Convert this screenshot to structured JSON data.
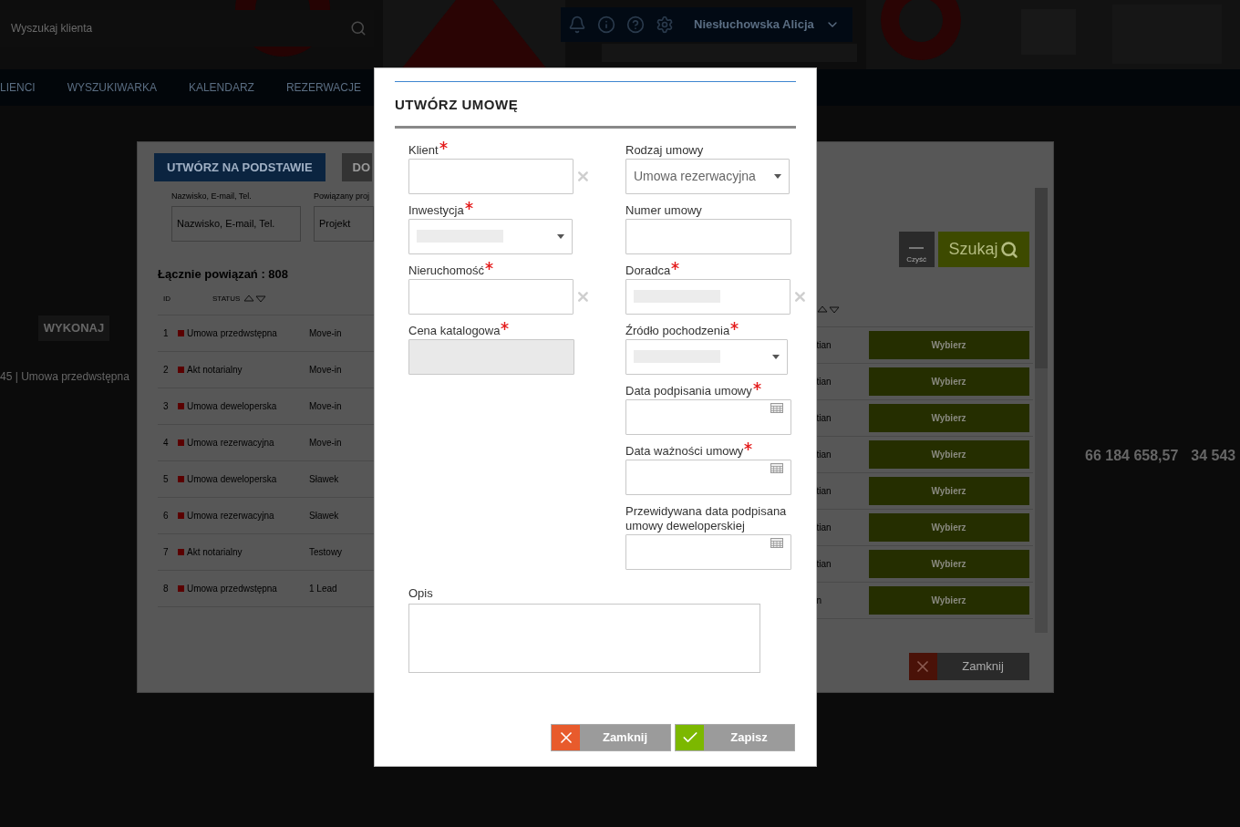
{
  "header": {
    "search_placeholder": "Wyszukaj klienta",
    "user": "Niesłuchowska Alicja"
  },
  "nav": [
    "LIENCI",
    "WYSZUKIWARKA",
    "KALENDARZ",
    "REZERWACJE"
  ],
  "background": {
    "action_button": "WYKONAJ",
    "record_title": "45 | Umowa przedwstępna",
    "totals": [
      "66 184 658,57",
      "34 543"
    ]
  },
  "list_dialog": {
    "buttons": [
      {
        "label": "UTWÓRZ NA PODSTAWIE",
        "selected": true
      },
      {
        "label": "DO",
        "selected": false
      }
    ],
    "filters": [
      {
        "label": "Nazwisko, E-mail, Tel.",
        "placeholder": "Nazwisko, E-mail, Tel."
      },
      {
        "label": "Powiązany proj",
        "placeholder": "Projekt"
      }
    ],
    "clear_button": "Czyść",
    "search_button": "Szukaj",
    "count": "Łącznie powiązań : 808",
    "columns": [
      "ID",
      "STATUS"
    ],
    "rows": [
      {
        "id": "1",
        "status": "Umowa przedwstępna",
        "project": "Move-in",
        "column_4": "tian",
        "action": "Wybierz"
      },
      {
        "id": "2",
        "status": "Akt notarialny",
        "project": "Move-in",
        "column_4": "tian",
        "action": "Wybierz"
      },
      {
        "id": "3",
        "status": "Umowa deweloperska",
        "project": "Move-in",
        "column_4": "tian",
        "action": "Wybierz"
      },
      {
        "id": "4",
        "status": "Umowa rezerwacyjna",
        "project": "Move-in",
        "column_4": "tian",
        "action": "Wybierz"
      },
      {
        "id": "5",
        "status": "Umowa deweloperska",
        "project": "Sławek",
        "column_4": "tian",
        "action": "Wybierz"
      },
      {
        "id": "6",
        "status": "Umowa rezerwacyjna",
        "project": "Sławek",
        "column_4": "tian",
        "action": "Wybierz"
      },
      {
        "id": "7",
        "status": "Akt notarialny",
        "project": "Testowy",
        "column_4": "tian",
        "action": "Wybierz"
      },
      {
        "id": "8",
        "status": "Umowa przedwstępna",
        "project": "1 Lead",
        "column_4": "n",
        "action": "Wybierz"
      }
    ],
    "close_button": "Zamknij"
  },
  "dialog": {
    "title": "UTWÓRZ UMOWĘ",
    "left_fields": [
      {
        "label": "Klient",
        "kind": "text",
        "required": true,
        "clearable": true
      },
      {
        "label": "Inwestycja",
        "kind": "select",
        "required": true,
        "redacted": true
      },
      {
        "label": "Nieruchomość",
        "kind": "text",
        "required": true,
        "clearable": true
      },
      {
        "label": "Cena katalogowa",
        "kind": "readonly",
        "required": true
      }
    ],
    "right_fields": [
      {
        "label": "Rodzaj umowy",
        "kind": "select",
        "required": false,
        "value": "Umowa rezerwacyjna"
      },
      {
        "label": "Numer umowy",
        "kind": "text",
        "required": false
      },
      {
        "label": "Doradca",
        "kind": "text",
        "required": true,
        "clearable": true,
        "redacted": true
      },
      {
        "label": "Źródło pochodzenia",
        "kind": "select",
        "required": true,
        "redacted": true
      },
      {
        "label": "Data podpisania umowy",
        "kind": "date",
        "required": true
      },
      {
        "label": "Data ważności umowy",
        "kind": "date",
        "required": true
      },
      {
        "label": "Przewidywana data podpisana umowy deweloperskiej",
        "kind": "date",
        "required": false
      }
    ],
    "description": {
      "label": "Opis"
    },
    "buttons": [
      {
        "label": "Zamknij",
        "kind": "cancel"
      },
      {
        "label": "Zapisz",
        "kind": "save"
      }
    ]
  }
}
